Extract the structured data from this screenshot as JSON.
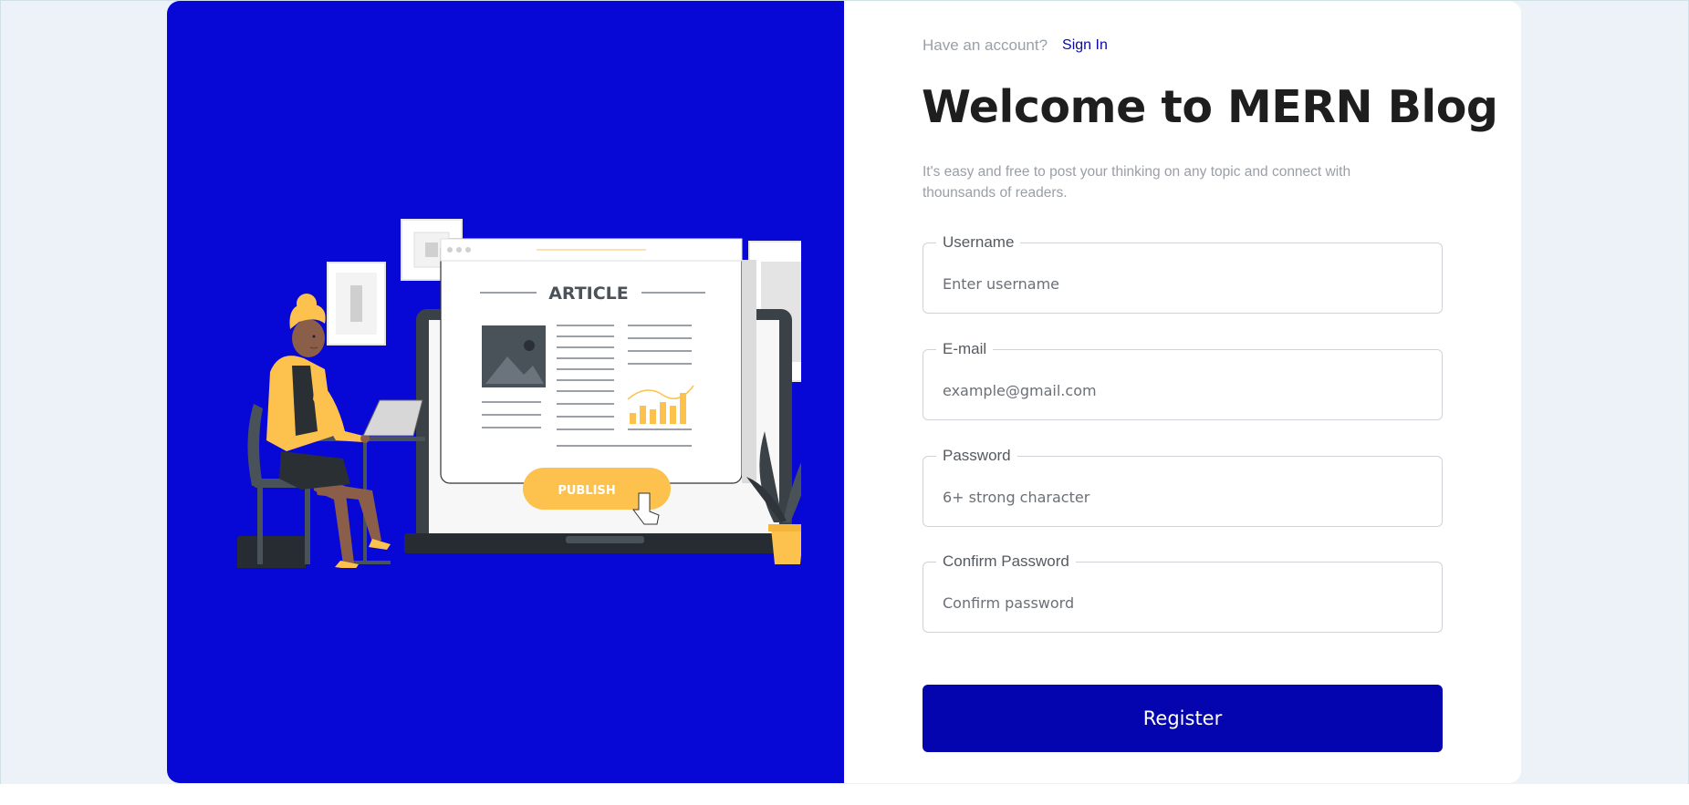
{
  "header": {
    "account_prompt": "Have an account?",
    "signin_label": "Sign In"
  },
  "main": {
    "title": "Welcome to MERN Blog",
    "subtitle": "It's easy and free to post your thinking on any topic and connect with thounsands of readers."
  },
  "form": {
    "fields": [
      {
        "label": "Username",
        "placeholder": "Enter username"
      },
      {
        "label": "E-mail",
        "placeholder": "example@gmail.com"
      },
      {
        "label": "Password",
        "placeholder": "6+ strong character"
      },
      {
        "label": "Confirm Password",
        "placeholder": "Confirm password"
      }
    ],
    "submit_label": "Register"
  },
  "illustration": {
    "heading": "ARTICLE",
    "button_label": "PUBLISH"
  },
  "colors": {
    "brand_blue": "#0808d6",
    "button_blue": "#0505b0",
    "link_blue": "#0a0aa0",
    "accent_yellow": "#fcc24d"
  }
}
